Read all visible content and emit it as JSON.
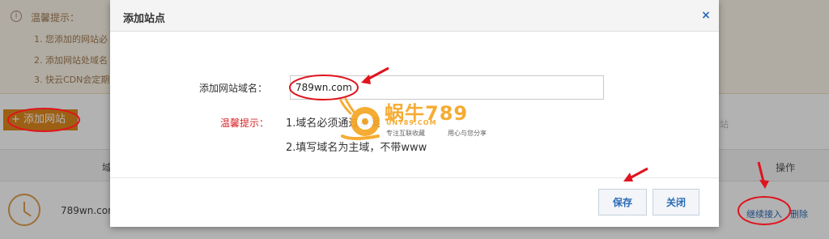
{
  "background": {
    "tips": {
      "title": "温馨提示：",
      "lines": [
        "1. 您添加的网站必",
        "2. 添加网站处域名",
        "3. 快云CDN会定期"
      ]
    },
    "add_site_button": "+ 添加网站",
    "search_hint": "网站",
    "table": {
      "header_domain": "域",
      "header_ops": "操作",
      "row": {
        "domain": "789wn.com",
        "continue_link": "继续接入",
        "delete_link": "删除"
      }
    }
  },
  "modal": {
    "title": "添加站点",
    "close_icon": "×",
    "field_label": "添加网站域名：",
    "domain_value": "789wn.com",
    "tip_label": "温馨提示：",
    "tip_lines": [
      "1.域名必须通过备案",
      "2.填写域名为主域，不带www"
    ],
    "save_button": "保存",
    "close_button": "关闭"
  },
  "watermark": {
    "title": "蜗牛789",
    "subtitle": "UN789.COM",
    "slogan_left": "专注互联收藏",
    "slogan_right": "用心与您分享"
  },
  "colors": {
    "accent_orange": "#e08a1e",
    "link_blue": "#2a6ab7",
    "annotation_red": "#e0141e",
    "tip_red": "#d9262a"
  }
}
